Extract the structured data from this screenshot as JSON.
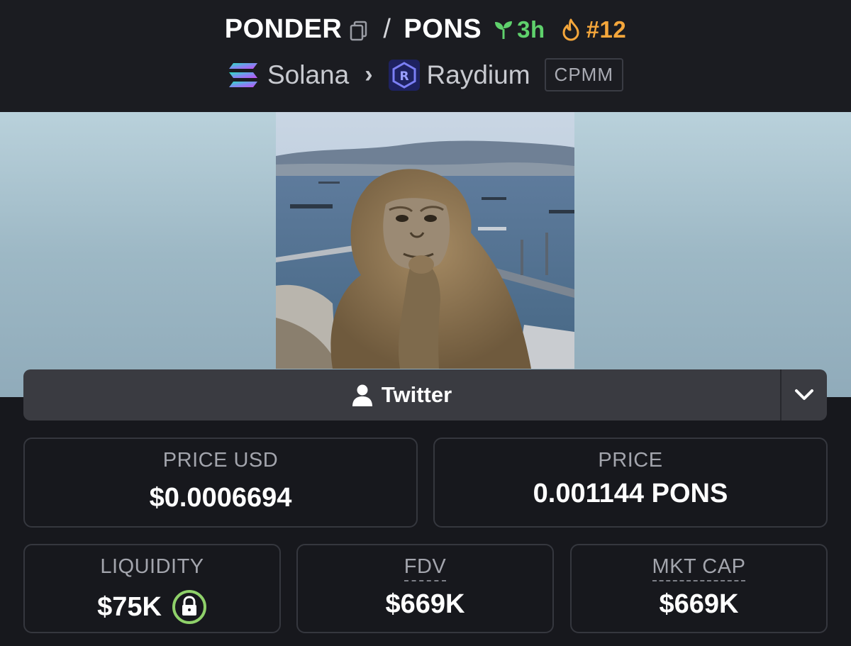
{
  "header": {
    "base_symbol": "PONDER",
    "separator": "/",
    "quote_symbol": "PONS",
    "age": "3h",
    "rank": "#12",
    "chain": "Solana",
    "dex": "Raydium",
    "pool_type": "CPMM",
    "colors": {
      "age": "#5fd16c",
      "rank": "#f4a63b"
    }
  },
  "social": {
    "twitter_label": "Twitter"
  },
  "stats": {
    "price_usd": {
      "label": "PRICE USD",
      "value": "$0.0006694"
    },
    "price": {
      "label": "PRICE",
      "value": "0.001144 PONS"
    },
    "liquidity": {
      "label": "LIQUIDITY",
      "value": "$75K"
    },
    "fdv": {
      "label": "FDV",
      "value": "$669K"
    },
    "mkt_cap": {
      "label": "MKT CAP",
      "value": "$669K"
    }
  },
  "icons": {
    "copy": "copy-icon",
    "age": "seedling-icon",
    "rank": "flame-icon",
    "chain": "solana-logo",
    "dex": "raydium-logo",
    "user": "user-icon",
    "expand": "chevron-down-icon",
    "lock": "lock-icon"
  }
}
